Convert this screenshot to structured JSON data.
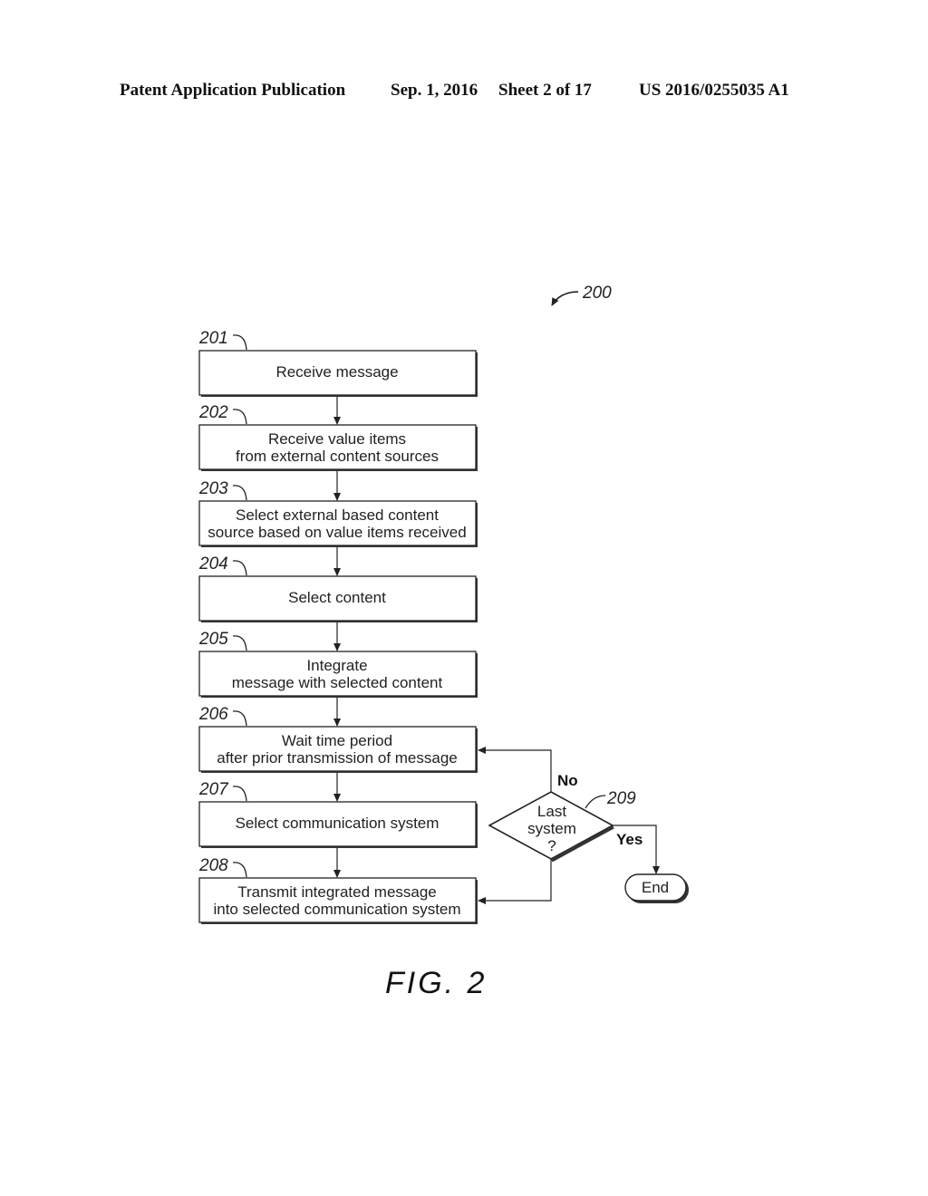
{
  "header": {
    "publication": "Patent Application Publication",
    "date": "Sep. 1, 2016",
    "sheet": "Sheet 2 of 17",
    "patent_number": "US 2016/0255035 A1"
  },
  "figure": {
    "ref": "200",
    "caption": "FIG. 2",
    "steps": [
      {
        "ref": "201",
        "lines": [
          "Receive message"
        ]
      },
      {
        "ref": "202",
        "lines": [
          "Receive value items",
          "from external content sources"
        ]
      },
      {
        "ref": "203",
        "lines": [
          "Select external based content",
          "source based on value items received"
        ]
      },
      {
        "ref": "204",
        "lines": [
          "Select content"
        ]
      },
      {
        "ref": "205",
        "lines": [
          "Integrate",
          "message with selected content"
        ]
      },
      {
        "ref": "206",
        "lines": [
          "Wait time period",
          "after prior transmission of message"
        ]
      },
      {
        "ref": "207",
        "lines": [
          "Select communication system"
        ]
      },
      {
        "ref": "208",
        "lines": [
          "Transmit integrated message",
          "into selected communication system"
        ]
      }
    ],
    "decision": {
      "ref": "209",
      "lines": [
        "Last",
        "system",
        "?"
      ],
      "no_label": "No",
      "yes_label": "Yes"
    },
    "terminal": {
      "label": "End"
    }
  }
}
